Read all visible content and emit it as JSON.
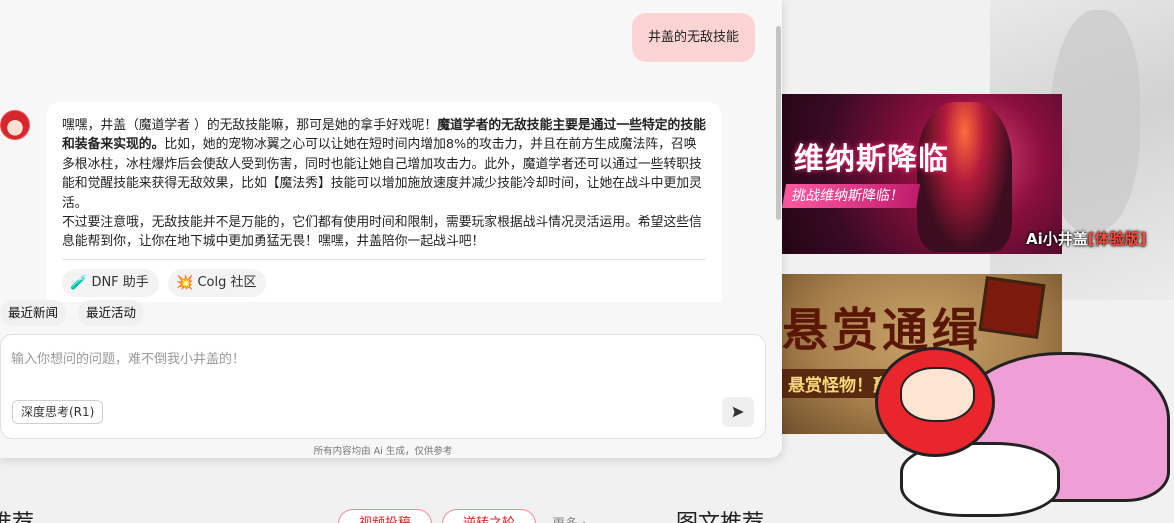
{
  "chat": {
    "user_message": "井盖的无敌技能",
    "bot_reply": {
      "p1_a": "嘿嘿，井盖（魔道学者 ）的无敌技能嘛，那可是她的拿手好戏呢！",
      "p1_bold": "魔道学者的无敌技能主要是通过一些特定的技能和装备来实现的。",
      "p1_b": "比如，她的宠物冰翼之心可以让她在短时间内增加8%的攻击力，并且在前方生成魔法阵，召唤多根冰柱，冰柱爆炸后会使敌人受到伤害，同时也能让她自己增加攻击力。此外，魔道学者还可以通过一些转职技能和觉醒技能来获得无敌效果，比如【魔法秀】技能可以增加施放速度并减少技能冷却时间，让她在战斗中更加灵活。",
      "p2": "不过要注意哦，无敌技能并不是万能的，它们都有使用时间和限制，需要玩家根据战斗情况灵活运用。希望这些信息能帮到你，让你在地下城中更加勇猛无畏！嘿嘿，井盖陪你一起战斗吧！"
    },
    "sources": [
      {
        "label": "DNF 助手",
        "icon": "potion-icon"
      },
      {
        "label": "Colg 社区",
        "icon": "sparkle-icon"
      }
    ],
    "quick_actions": [
      "最近新闻",
      "最近活动"
    ],
    "input": {
      "placeholder": "输入你想问的问题，难不倒我小井盖的！",
      "value": ""
    },
    "deep_think_label": "深度思考(R1)",
    "disclaimer": "所有内容均由 Ai 生成，仅供参考"
  },
  "banners": {
    "banner1_title": "维纳斯降临",
    "banner1_cta": "挑战维纳斯降临！",
    "banner2_title": "悬赏通缉",
    "banner2_sub": "悬赏怪物！赢"
  },
  "watermark": {
    "name": "Ai小井盖",
    "tag": "[体验版]"
  },
  "page_bottom": {
    "left_heading": "推荐",
    "pills": [
      "视频投稿",
      "逆转之轮"
    ],
    "more": "更多 ›",
    "right_heading": "图文推荐"
  },
  "colors": {
    "user_bubble": "#fcd4d4",
    "chat_bg": "#f7f7f8",
    "accent_red": "#e8262c"
  }
}
